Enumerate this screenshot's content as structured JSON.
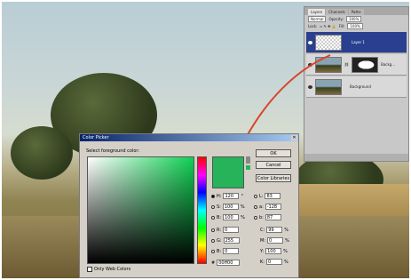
{
  "layers_panel": {
    "tabs": [
      "Layers",
      "Channels",
      "Paths"
    ],
    "blend_mode": "Normal",
    "opacity_label": "Opacity:",
    "opacity_value": "100%",
    "lock_label": "Lock:",
    "fill_label": "Fill:",
    "fill_value": "100%",
    "layers": [
      {
        "name": "Layer 1",
        "active": true
      },
      {
        "name": "Backg...",
        "active": false
      },
      {
        "name": "Background",
        "active": false
      }
    ]
  },
  "color_picker": {
    "title": "Color Picker",
    "prompt": "Select foreground color:",
    "buttons": {
      "ok": "OK",
      "cancel": "Cancel",
      "libraries": "Color Libraries"
    },
    "hsb": [
      {
        "label": "H:",
        "value": "120",
        "unit": "°",
        "selected": true
      },
      {
        "label": "S:",
        "value": "100",
        "unit": "%",
        "selected": false
      },
      {
        "label": "B:",
        "value": "100",
        "unit": "%",
        "selected": false
      }
    ],
    "rgb": [
      {
        "label": "R:",
        "value": "0"
      },
      {
        "label": "G:",
        "value": "255"
      },
      {
        "label": "B:",
        "value": "0"
      }
    ],
    "lab": [
      {
        "label": "L:",
        "value": "83"
      },
      {
        "label": "a:",
        "value": "-128"
      },
      {
        "label": "b:",
        "value": "87"
      }
    ],
    "cmyk": [
      {
        "label": "C:",
        "value": "99",
        "unit": "%"
      },
      {
        "label": "M:",
        "value": "0",
        "unit": "%"
      },
      {
        "label": "Y:",
        "value": "100",
        "unit": "%"
      },
      {
        "label": "K:",
        "value": "0",
        "unit": "%"
      }
    ],
    "hex_label": "#",
    "hex_value": "00ff00",
    "web_only_label": "Only Web Colors",
    "swatch_color": "#26b35a"
  }
}
